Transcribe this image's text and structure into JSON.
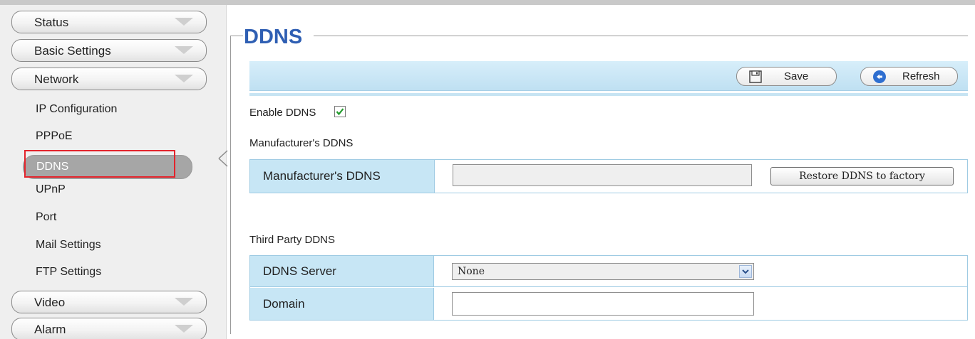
{
  "sidebar": {
    "menus": [
      {
        "label": "Status"
      },
      {
        "label": "Basic Settings"
      },
      {
        "label": "Network"
      },
      {
        "label": "Video"
      },
      {
        "label": "Alarm"
      }
    ],
    "network_items": [
      {
        "label": "IP Configuration"
      },
      {
        "label": "PPPoE"
      },
      {
        "label": "DDNS"
      },
      {
        "label": "UPnP"
      },
      {
        "label": "Port"
      },
      {
        "label": "Mail Settings"
      },
      {
        "label": "FTP Settings"
      }
    ],
    "active_item": "DDNS"
  },
  "main": {
    "title": "DDNS",
    "toolbar": {
      "save_label": "Save",
      "refresh_label": "Refresh"
    },
    "enable_label": "Enable DDNS",
    "enable_checked": true,
    "manufacturer_section": "Manufacturer's DDNS",
    "manufacturer_table": {
      "label": "Manufacturer's DDNS",
      "value": "",
      "restore_label": "Restore DDNS to factory"
    },
    "third_party_section": "Third Party DDNS",
    "third_party_table": {
      "server_label": "DDNS Server",
      "server_value": "None",
      "domain_label": "Domain",
      "domain_value": ""
    }
  },
  "colors": {
    "title": "#2f5fb3",
    "toolbar": "#c7e6f5",
    "highlight": "#e3232b",
    "active_item": "#a6a6a6"
  },
  "icons": [
    "chevron-down-icon",
    "save-icon",
    "refresh-icon",
    "checkmark-icon",
    "dropdown-arrow-icon",
    "pointer-icon"
  ]
}
